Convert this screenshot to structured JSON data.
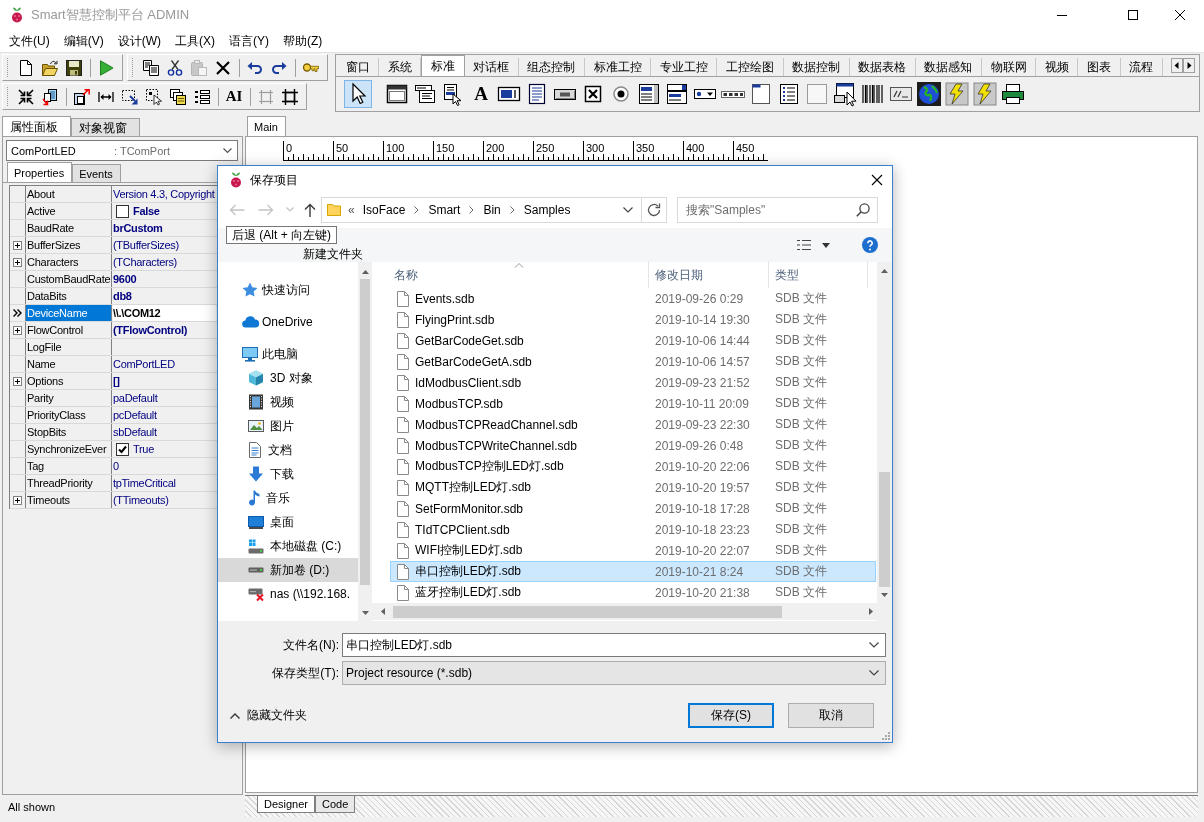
{
  "window": {
    "title": "Smart智慧控制平台 ADMIN"
  },
  "menu": [
    "文件(U)",
    "编辑(V)",
    "设计(W)",
    "工具(X)",
    "语言(Y)",
    "帮助(Z)"
  ],
  "toolbar_rows": [
    [
      {
        "groups": [
          [
            {
              "kind": "new",
              "disabled": false
            },
            {
              "kind": "open",
              "disabled": false
            },
            {
              "kind": "save",
              "disabled": false
            }
          ],
          [
            {
              "kind": "run",
              "disabled": false
            }
          ]
        ]
      },
      {
        "groups": [
          [
            {
              "kind": "copy",
              "disabled": false
            },
            {
              "kind": "cut",
              "disabled": false
            },
            {
              "kind": "paste",
              "disabled": true
            },
            {
              "kind": "delete",
              "disabled": false
            }
          ],
          [
            {
              "kind": "undo",
              "disabled": false
            },
            {
              "kind": "redo",
              "disabled": false
            }
          ],
          [
            {
              "kind": "key",
              "disabled": false
            }
          ]
        ]
      }
    ],
    [
      {
        "groups": [
          [
            {
              "kind": "shrink",
              "disabled": false
            },
            {
              "kind": "page-transfer",
              "disabled": false
            }
          ],
          [
            {
              "kind": "page-arrow",
              "disabled": false
            },
            {
              "kind": "spacing",
              "disabled": false
            },
            {
              "kind": "dashed-arrow",
              "disabled": false
            },
            {
              "kind": "dashed-cursor",
              "disabled": false
            },
            {
              "kind": "windows",
              "disabled": false
            },
            {
              "kind": "list-lines",
              "disabled": false
            }
          ],
          [
            {
              "kind": "font",
              "text": "AI",
              "disabled": false
            }
          ],
          [
            {
              "kind": "frame",
              "disabled": true
            },
            {
              "kind": "frame-corners",
              "disabled": false
            }
          ]
        ]
      }
    ]
  ],
  "palette": {
    "tabs": [
      {
        "label": "窗口",
        "selected": false
      },
      {
        "label": "系统",
        "selected": false
      },
      {
        "label": "标准",
        "selected": true
      },
      {
        "label": "对话框",
        "selected": false
      },
      {
        "label": "组态控制",
        "selected": false
      },
      {
        "label": "标准工控",
        "selected": false
      },
      {
        "label": "专业工控",
        "selected": false
      },
      {
        "label": "工控绘图",
        "selected": false
      },
      {
        "label": "数据控制",
        "selected": false
      },
      {
        "label": "数据表格",
        "selected": false
      },
      {
        "label": "数据感知",
        "selected": false
      },
      {
        "label": "物联网",
        "selected": false
      },
      {
        "label": "视频",
        "selected": false
      },
      {
        "label": "图表",
        "selected": false
      },
      {
        "label": "流程",
        "selected": false
      }
    ],
    "tools": [
      {
        "kind": "pointer",
        "selected": true
      },
      {
        "kind": "form",
        "selected": false
      },
      {
        "kind": "menu",
        "selected": false
      },
      {
        "kind": "popup",
        "selected": false
      },
      {
        "kind": "label",
        "text": "A",
        "selected": false
      },
      {
        "kind": "edit",
        "selected": false
      },
      {
        "kind": "memo",
        "selected": false
      },
      {
        "kind": "button",
        "selected": false
      },
      {
        "kind": "checkbox",
        "selected": false
      },
      {
        "kind": "radio",
        "selected": false
      },
      {
        "kind": "listbox",
        "selected": false
      },
      {
        "kind": "combobox",
        "selected": false
      },
      {
        "kind": "dropdown",
        "selected": false
      },
      {
        "kind": "segments",
        "selected": false
      },
      {
        "kind": "tabpage",
        "selected": false
      },
      {
        "kind": "bullets",
        "selected": false
      },
      {
        "kind": "panel",
        "selected": false
      },
      {
        "kind": "form-button",
        "selected": false
      },
      {
        "kind": "barcode",
        "selected": false
      },
      {
        "kind": "display",
        "selected": false
      },
      {
        "kind": "globe",
        "selected": false
      },
      {
        "kind": "lightning",
        "selected": false
      },
      {
        "kind": "lightning",
        "selected": false
      },
      {
        "kind": "printer",
        "selected": false
      }
    ]
  },
  "inspector": {
    "tabs": [
      {
        "label": "属性面板",
        "selected": true
      },
      {
        "label": "对象视窗",
        "selected": false
      }
    ],
    "component": {
      "name": "ComPortLED",
      "type": ": TComPort"
    },
    "subtabs": [
      {
        "label": "Properties",
        "selected": true
      },
      {
        "label": "Events",
        "selected": false
      }
    ],
    "properties": [
      {
        "name": "About",
        "value": "Version 4.3, Copyright",
        "kind": "text",
        "expandable": false,
        "bold": false,
        "selected": false
      },
      {
        "name": "Active",
        "value": "False",
        "kind": "check",
        "checked": false,
        "expandable": false,
        "bold": true,
        "selected": false
      },
      {
        "name": "BaudRate",
        "value": "brCustom",
        "kind": "text",
        "expandable": false,
        "bold": true,
        "selected": false
      },
      {
        "name": "BufferSizes",
        "value": "(TBufferSizes)",
        "kind": "text",
        "expandable": true,
        "bold": false,
        "selected": false
      },
      {
        "name": "Characters",
        "value": "(TCharacters)",
        "kind": "text",
        "expandable": true,
        "bold": false,
        "selected": false
      },
      {
        "name": "CustomBaudRate",
        "value": "9600",
        "kind": "text",
        "expandable": false,
        "bold": true,
        "selected": false
      },
      {
        "name": "DataBits",
        "value": "db8",
        "kind": "text",
        "expandable": false,
        "bold": true,
        "selected": false
      },
      {
        "name": "DeviceName",
        "value": "\\\\.\\COM12",
        "kind": "text",
        "expandable": false,
        "bold": true,
        "selected": true
      },
      {
        "name": "FlowControl",
        "value": "(TFlowControl)",
        "kind": "text",
        "expandable": true,
        "bold": true,
        "selected": false
      },
      {
        "name": "LogFile",
        "kind": "text",
        "expandable": false,
        "selected": false
      },
      {
        "name": "Name",
        "value": "ComPortLED",
        "kind": "text",
        "expandable": false,
        "bold": false,
        "selected": false
      },
      {
        "name": "Options",
        "value": "[]",
        "kind": "text",
        "expandable": true,
        "bold": true,
        "selected": false
      },
      {
        "name": "Parity",
        "value": "paDefault",
        "kind": "text",
        "expandable": false,
        "bold": false,
        "selected": false
      },
      {
        "name": "PriorityClass",
        "value": "pcDefault",
        "kind": "text",
        "expandable": false,
        "bold": false,
        "selected": false
      },
      {
        "name": "StopBits",
        "value": "sbDefault",
        "kind": "text",
        "expandable": false,
        "bold": false,
        "selected": false
      },
      {
        "name": "SynchronizeEver",
        "value": "True",
        "kind": "check",
        "checked": true,
        "expandable": false,
        "bold": false,
        "selected": false
      },
      {
        "name": "Tag",
        "value": "0",
        "kind": "text",
        "expandable": false,
        "bold": false,
        "selected": false
      },
      {
        "name": "ThreadPriority",
        "value": "tpTimeCritical",
        "kind": "text",
        "expandable": false,
        "bold": false,
        "selected": false
      },
      {
        "name": "Timeouts",
        "value": "(TTimeouts)",
        "kind": "text",
        "expandable": true,
        "bold": false,
        "selected": false
      }
    ],
    "status": "All shown"
  },
  "designer": {
    "tabs": [
      {
        "label": "Main",
        "selected": true
      }
    ],
    "ruler": [
      "0",
      "50",
      "100",
      "150",
      "200",
      "250",
      "300",
      "350",
      "400",
      "450"
    ],
    "bottom_tabs": [
      {
        "label": "Designer",
        "selected": true
      },
      {
        "label": "Code",
        "selected": false
      }
    ]
  },
  "dialog": {
    "title": "保存项目",
    "nav_buttons": [
      {
        "kind": "back",
        "disabled": true
      },
      {
        "kind": "forward",
        "disabled": true
      },
      {
        "kind": "recent",
        "disabled": true
      },
      {
        "kind": "up",
        "disabled": false
      }
    ],
    "address": {
      "overflow": "«",
      "crumbs": [
        "IsoFace",
        "Smart",
        "Bin",
        "Samples"
      ]
    },
    "search": {
      "placeholder": "搜索\"Samples\""
    },
    "tooltip": "后退 (Alt + 向左键)",
    "new_folder": "新建文件夹",
    "nav": [
      {
        "label": "快速访问",
        "kind": "star",
        "selected": false
      },
      {
        "label": "OneDrive",
        "kind": "cloud",
        "selected": false
      },
      {
        "label": "此电脑",
        "kind": "computer",
        "selected": false,
        "children": [
          {
            "label": "3D 对象",
            "kind": "cube",
            "selected": false
          },
          {
            "label": "视频",
            "kind": "film",
            "selected": false
          },
          {
            "label": "图片",
            "kind": "picture",
            "selected": false
          },
          {
            "label": "文档",
            "kind": "document",
            "selected": false
          },
          {
            "label": "下载",
            "kind": "download",
            "selected": false
          },
          {
            "label": "音乐",
            "kind": "music",
            "selected": false
          },
          {
            "label": "桌面",
            "kind": "desktop",
            "selected": false
          },
          {
            "label": "本地磁盘 (C:)",
            "kind": "system-drive",
            "selected": false
          },
          {
            "label": "新加卷 (D:)",
            "kind": "drive",
            "selected": true
          },
          {
            "label": "nas (\\\\192.168.",
            "kind": "network-drive",
            "selected": false
          }
        ]
      }
    ],
    "columns": [
      {
        "label": "名称",
        "sorted": true
      },
      {
        "label": "修改日期",
        "sorted": false
      },
      {
        "label": "类型",
        "sorted": false
      }
    ],
    "files": [
      {
        "name": "Events.sdb",
        "date": "2019-09-26 0:29",
        "type": "SDB 文件",
        "selected": false
      },
      {
        "name": "FlyingPrint.sdb",
        "date": "2019-10-14 19:30",
        "type": "SDB 文件",
        "selected": false
      },
      {
        "name": "GetBarCodeGet.sdb",
        "date": "2019-10-06 14:44",
        "type": "SDB 文件",
        "selected": false
      },
      {
        "name": "GetBarCodeGetA.sdb",
        "date": "2019-10-06 14:57",
        "type": "SDB 文件",
        "selected": false
      },
      {
        "name": "IdModbusClient.sdb",
        "date": "2019-09-23 21:52",
        "type": "SDB 文件",
        "selected": false
      },
      {
        "name": "ModbusTCP.sdb",
        "date": "2019-10-11 20:09",
        "type": "SDB 文件",
        "selected": false
      },
      {
        "name": "ModbusTCPReadChannel.sdb",
        "date": "2019-09-23 22:30",
        "type": "SDB 文件",
        "selected": false
      },
      {
        "name": "ModbusTCPWriteChannel.sdb",
        "date": "2019-09-26 0:48",
        "type": "SDB 文件",
        "selected": false
      },
      {
        "name": "ModbusTCP控制LED灯.sdb",
        "date": "2019-10-20 22:06",
        "type": "SDB 文件",
        "selected": false
      },
      {
        "name": "MQTT控制LED灯.sdb",
        "date": "2019-10-20 19:57",
        "type": "SDB 文件",
        "selected": false
      },
      {
        "name": "SetFormMonitor.sdb",
        "date": "2019-10-18 17:28",
        "type": "SDB 文件",
        "selected": false
      },
      {
        "name": "TIdTCPClient.sdb",
        "date": "2019-10-18 23:23",
        "type": "SDB 文件",
        "selected": false
      },
      {
        "name": "WIFI控制LED灯.sdb",
        "date": "2019-10-20 22:07",
        "type": "SDB 文件",
        "selected": false
      },
      {
        "name": "串口控制LED灯.sdb",
        "date": "2019-10-21 8:24",
        "type": "SDB 文件",
        "selected": true
      },
      {
        "name": "蓝牙控制LED灯.sdb",
        "date": "2019-10-20 21:38",
        "type": "SDB 文件",
        "selected": false
      }
    ],
    "file_name": {
      "label": "文件名(N):",
      "value": "串口控制LED灯.sdb"
    },
    "file_type": {
      "label": "保存类型(T):",
      "value": "Project resource (*.sdb)"
    },
    "hide_folders": "隐藏文件夹",
    "buttons": [
      {
        "label": "保存(S)",
        "default": true
      },
      {
        "label": "取消",
        "default": false
      }
    ]
  }
}
